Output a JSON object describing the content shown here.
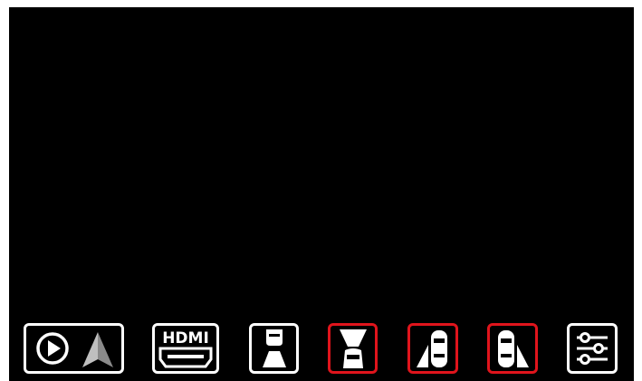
{
  "colors": {
    "screen_background": "#000000",
    "icon": "#ffffff",
    "border_default": "#ffffff",
    "border_active": "#e0141c"
  },
  "dock": {
    "buttons": [
      {
        "id": "carplay-android-auto",
        "icon": "play-circle-and-android-auto-icon",
        "active": false
      },
      {
        "id": "hdmi",
        "icon": "hdmi-icon",
        "label": "HDMI",
        "active": false
      },
      {
        "id": "front-rear-camera",
        "icon": "front-rear-camera-icon",
        "active": false
      },
      {
        "id": "rear-camera",
        "icon": "rear-camera-view-icon",
        "active": true
      },
      {
        "id": "left-camera",
        "icon": "left-camera-view-icon",
        "active": true
      },
      {
        "id": "right-camera",
        "icon": "right-camera-view-icon",
        "active": true
      },
      {
        "id": "settings",
        "icon": "sliders-settings-icon",
        "active": false
      }
    ]
  }
}
